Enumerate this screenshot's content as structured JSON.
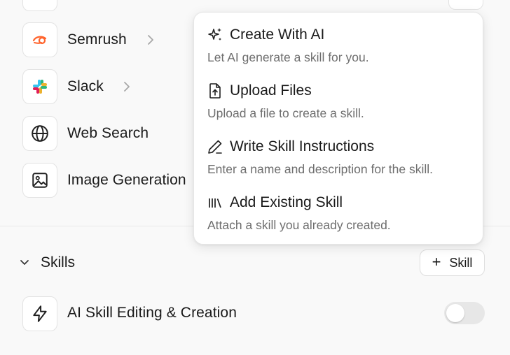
{
  "tools": {
    "items": [
      {
        "label": "Semrush",
        "icon": "semrush-logo-icon",
        "has_chevron": true
      },
      {
        "label": "Slack",
        "icon": "slack-logo-icon",
        "has_chevron": true
      },
      {
        "label": "Web Search",
        "icon": "globe-icon",
        "has_chevron": false
      },
      {
        "label": "Image Generation",
        "icon": "image-icon",
        "has_chevron": false
      }
    ]
  },
  "dropdown": {
    "items": [
      {
        "title": "Create With AI",
        "description": "Let AI generate a skill for you.",
        "icon": "sparkles-icon"
      },
      {
        "title": "Upload Files",
        "description": "Upload a file to create a skill.",
        "icon": "file-upload-icon"
      },
      {
        "title": "Write Skill Instructions",
        "description": "Enter a name and description for the skill.",
        "icon": "pencil-icon"
      },
      {
        "title": "Add Existing Skill",
        "description": "Attach a skill you already created.",
        "icon": "library-icon"
      }
    ]
  },
  "skills": {
    "header": "Skills",
    "add_button": {
      "plus": "+",
      "label": "Skill"
    },
    "items": [
      {
        "label": "AI Skill Editing & Creation",
        "icon": "lightning-icon",
        "enabled": false
      }
    ]
  },
  "colors": {
    "background": "#f9f9f9",
    "semrush_orange": "#ff642d",
    "toggle_off": "#e7e7e7"
  }
}
